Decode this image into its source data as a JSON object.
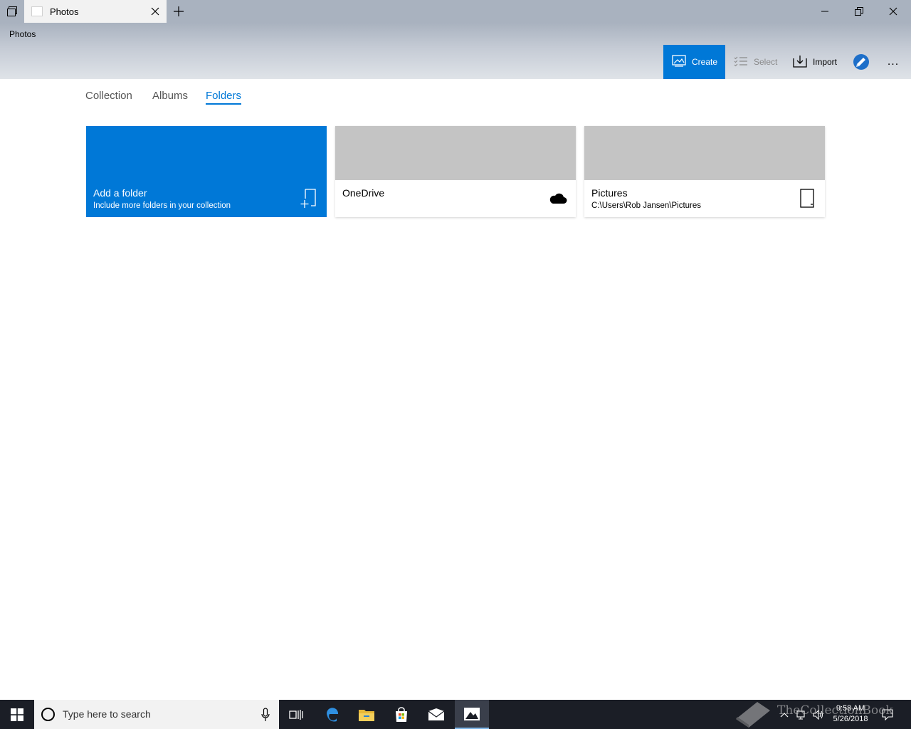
{
  "window": {
    "tab_title": "Photos",
    "app_title": "Photos"
  },
  "toolbar": {
    "create_label": "Create",
    "select_label": "Select",
    "import_label": "Import",
    "more_label": "..."
  },
  "nav": {
    "tabs": [
      {
        "label": "Collection",
        "active": false
      },
      {
        "label": "Albums",
        "active": false
      },
      {
        "label": "Folders",
        "active": true
      }
    ]
  },
  "folders": {
    "add": {
      "title": "Add a folder",
      "subtitle": "Include more folders in your collection",
      "icon": "add-folder-icon"
    },
    "items": [
      {
        "title": "OneDrive",
        "subtitle": "",
        "icon": "cloud-icon"
      },
      {
        "title": "Pictures",
        "subtitle": "C:\\Users\\Rob Jansen\\Pictures",
        "icon": "device-folder-icon"
      }
    ]
  },
  "taskbar": {
    "search_placeholder": "Type here to search",
    "time": "9:58 AM",
    "date": "5/26/2018",
    "pinned": [
      "task-view-icon",
      "edge-icon",
      "file-explorer-icon",
      "store-icon",
      "mail-icon",
      "photos-icon"
    ]
  },
  "watermark": "TheCollectionBook",
  "colors": {
    "accent": "#0078d7",
    "titlebar": "#a9b2bf",
    "taskbar": "#1b1e26"
  }
}
